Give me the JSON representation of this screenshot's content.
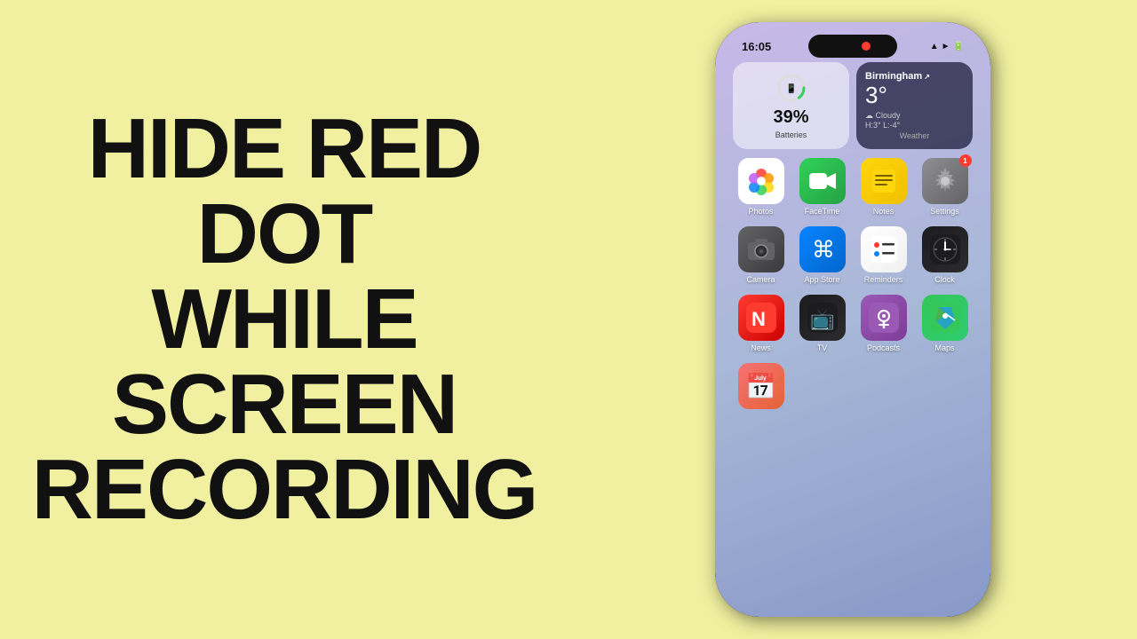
{
  "left": {
    "title_line1": "HIDE RED",
    "title_line2": "DOT",
    "title_line3": "WHILE",
    "title_line4": "SCREEN",
    "title_line5": "RECORDING"
  },
  "phone": {
    "status": {
      "time": "16:05",
      "signal": "▲",
      "battery": "39"
    },
    "widgets": {
      "battery": {
        "label": "Batteries",
        "percent": "39%"
      },
      "weather": {
        "label": "Weather",
        "city": "Birmingham",
        "temp": "3°",
        "condition": "Cloudy",
        "high_low": "H:3° L:-4°"
      }
    },
    "apps_row1": [
      {
        "name": "Photos",
        "icon": "photos"
      },
      {
        "name": "FaceTime",
        "icon": "facetime"
      },
      {
        "name": "Notes",
        "icon": "notes"
      },
      {
        "name": "Settings",
        "icon": "settings",
        "badge": "1"
      }
    ],
    "apps_row2": [
      {
        "name": "Camera",
        "icon": "camera"
      },
      {
        "name": "App Store",
        "icon": "appstore"
      },
      {
        "name": "Reminders",
        "icon": "reminders"
      },
      {
        "name": "Clock",
        "icon": "clock"
      }
    ],
    "apps_row3": [
      {
        "name": "News",
        "icon": "news"
      },
      {
        "name": "TV",
        "icon": "tv"
      },
      {
        "name": "Podcasts",
        "icon": "podcasts"
      },
      {
        "name": "Maps",
        "icon": "maps"
      }
    ]
  }
}
